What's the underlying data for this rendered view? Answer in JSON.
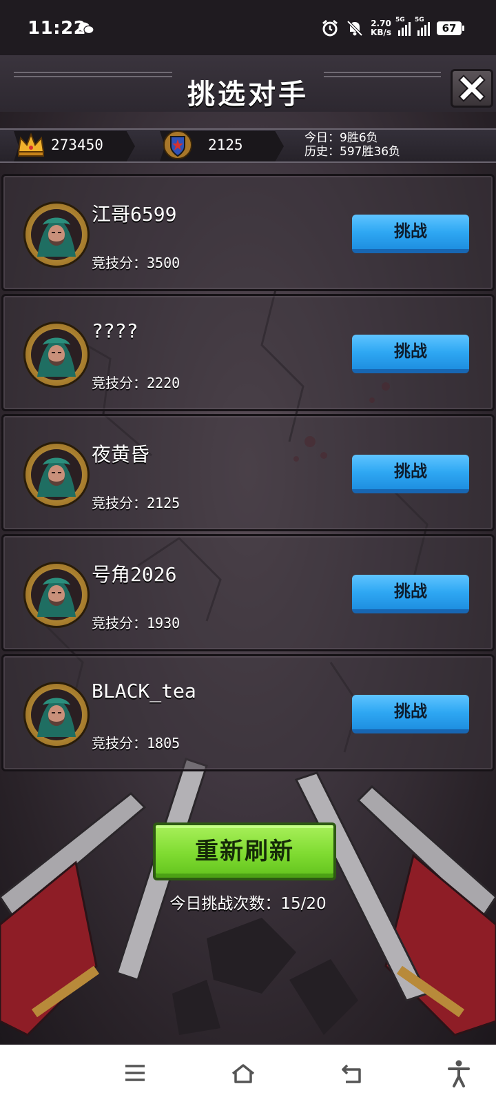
{
  "status_bar": {
    "time": "11:22",
    "net_speed_value": "2.70",
    "net_speed_unit": "KB/s",
    "sim1_label": "5G",
    "sim2_label": "5G",
    "battery": "67",
    "icons": [
      "wechat-icon",
      "alarm-icon",
      "mute-icon",
      "signal-icon",
      "battery-icon"
    ]
  },
  "header": {
    "title": "挑选对手",
    "close_icon": "close-icon"
  },
  "stats": {
    "gold": "273450",
    "gold_icon": "crown-icon",
    "arena_score": "2125",
    "arena_icon": "shield-emblem-icon",
    "today_record": "今日：9胜6负",
    "history_record": "历史：597胜36负"
  },
  "opponents": [
    {
      "name": "江哥6599",
      "score": "竞技分：3500",
      "button": "挑战"
    },
    {
      "name": "????",
      "score": "竞技分：2220",
      "button": "挑战"
    },
    {
      "name": "夜黄昏",
      "score": "竞技分：2125",
      "button": "挑战"
    },
    {
      "name": "号角2026",
      "score": "竞技分：1930",
      "button": "挑战"
    },
    {
      "name": "BLACK_tea",
      "score": "竞技分：1805",
      "button": "挑战"
    }
  ],
  "refresh_button": "重新刷新",
  "today_challenges": "今日挑战次数：15/20",
  "nav_bar": {
    "icons": [
      "menu-icon",
      "home-icon",
      "back-icon",
      "accessibility-icon"
    ]
  },
  "colors": {
    "challenge_button": "#2fa8f3",
    "refresh_button": "#7fdb31",
    "background": "#3f363f"
  }
}
